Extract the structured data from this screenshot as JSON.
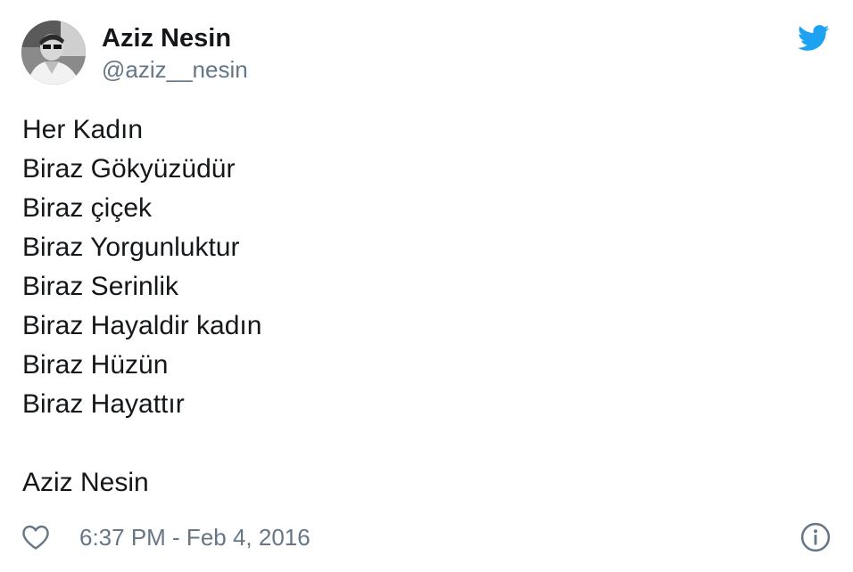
{
  "author": {
    "display_name": "Aziz Nesin",
    "handle": "@aziz__nesin"
  },
  "tweet": {
    "lines": [
      "Her Kadın",
      "Biraz Gökyüzüdür",
      "Biraz çiçek",
      "Biraz Yorgunluktur",
      "Biraz Serinlik",
      "Biraz Hayaldir kadın",
      "Biraz Hüzün",
      "Biraz Hayattır"
    ],
    "signature": "Aziz Nesin"
  },
  "footer": {
    "timestamp": "6:37 PM - Feb 4, 2016"
  },
  "icons": {
    "brand": "twitter-bird-icon",
    "like": "heart-icon",
    "info": "info-icon"
  },
  "colors": {
    "brand": "#1da1f2",
    "text": "#14171a",
    "secondary": "#657786"
  }
}
